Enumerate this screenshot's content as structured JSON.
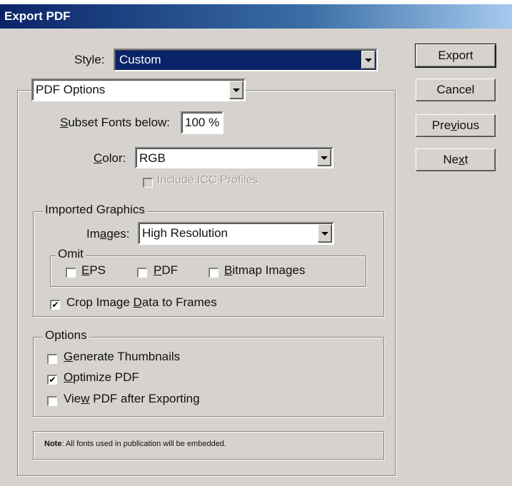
{
  "title": "Export PDF",
  "style": {
    "label": "Style:",
    "value": "Custom"
  },
  "section_dropdown": {
    "value": "PDF Options"
  },
  "buttons": {
    "export": "Export",
    "cancel": "Cancel",
    "previous_pre": "Pre",
    "previous_key": "v",
    "previous_post": "ious",
    "next_pre": "Ne",
    "next_key": "x",
    "next_post": "t"
  },
  "subset_fonts": {
    "key": "S",
    "label": "ubset Fonts below:",
    "value": "100 %"
  },
  "color": {
    "key": "C",
    "label": "olor:",
    "value": "RGB"
  },
  "include_icc": {
    "label": "Include ICC Profiles",
    "checked": false
  },
  "imported_graphics": {
    "title": "Imported Graphics",
    "images_pre": "Im",
    "images_key": "a",
    "images_post": "ges:",
    "images_value": "High Resolution",
    "omit": {
      "title": "Omit",
      "eps_key": "E",
      "eps_rest": "PS",
      "pdf_key": "P",
      "pdf_rest": "DF",
      "bitmap_key": "B",
      "bitmap_rest": "itmap Images"
    },
    "crop_pre": "Crop Image ",
    "crop_key": "D",
    "crop_post": "ata to Frames",
    "crop_checked": true
  },
  "options": {
    "title": "Options",
    "thumbs_key": "G",
    "thumbs_rest": "enerate Thumbnails",
    "optimize_key": "O",
    "optimize_rest": "ptimize PDF",
    "view_pre": "Vie",
    "view_key": "w",
    "view_post": " PDF after Exporting"
  },
  "note": {
    "bold": "Note",
    "text": ":  All fonts used in publication will be embedded."
  },
  "check_glyph": "✔"
}
